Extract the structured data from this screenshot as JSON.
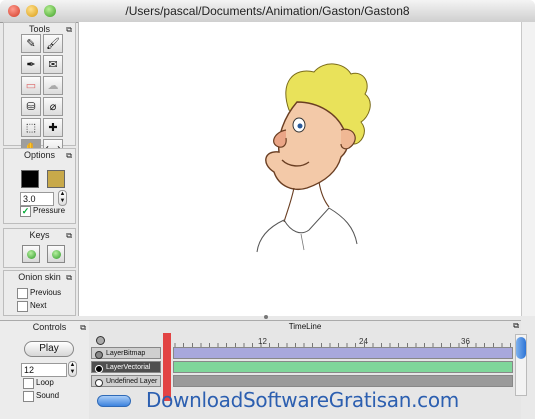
{
  "window": {
    "title": "/Users/pascal/Documents/Animation/Gaston/Gaston8"
  },
  "tools": {
    "header": "Tools",
    "items": [
      {
        "name": "eraser"
      },
      {
        "name": "brush"
      },
      {
        "name": "pen"
      },
      {
        "name": "envelope"
      },
      {
        "name": "rubber"
      },
      {
        "name": "smudge"
      },
      {
        "name": "bucket"
      },
      {
        "name": "eyedropper"
      },
      {
        "name": "select"
      },
      {
        "name": "move"
      },
      {
        "name": "hand"
      },
      {
        "name": "resize"
      }
    ]
  },
  "options": {
    "header": "Options",
    "primary_color": "#000000",
    "secondary_color": "#c8a94a",
    "size_value": "3.0",
    "pressure_label": "Pressure",
    "pressure_checked": true
  },
  "keys": {
    "header": "Keys"
  },
  "onion_skin": {
    "header": "Onion skin",
    "previous_label": "Previous",
    "next_label": "Next"
  },
  "controls": {
    "header": "Controls",
    "play_label": "Play",
    "fps_value": "12",
    "loop_label": "Loop",
    "sound_label": "Sound"
  },
  "timeline": {
    "title": "TimeLine",
    "ticks": [
      "12",
      "24",
      "36"
    ],
    "layers": [
      {
        "name": "LayerBitmap",
        "color": "#a8a8dc"
      },
      {
        "name": "LayerVectorial",
        "color": "#7fd69a"
      },
      {
        "name": "Undefined Layer",
        "color": "#9a9a9a"
      }
    ]
  },
  "watermark": "DownloadSoftwareGratisan.com"
}
